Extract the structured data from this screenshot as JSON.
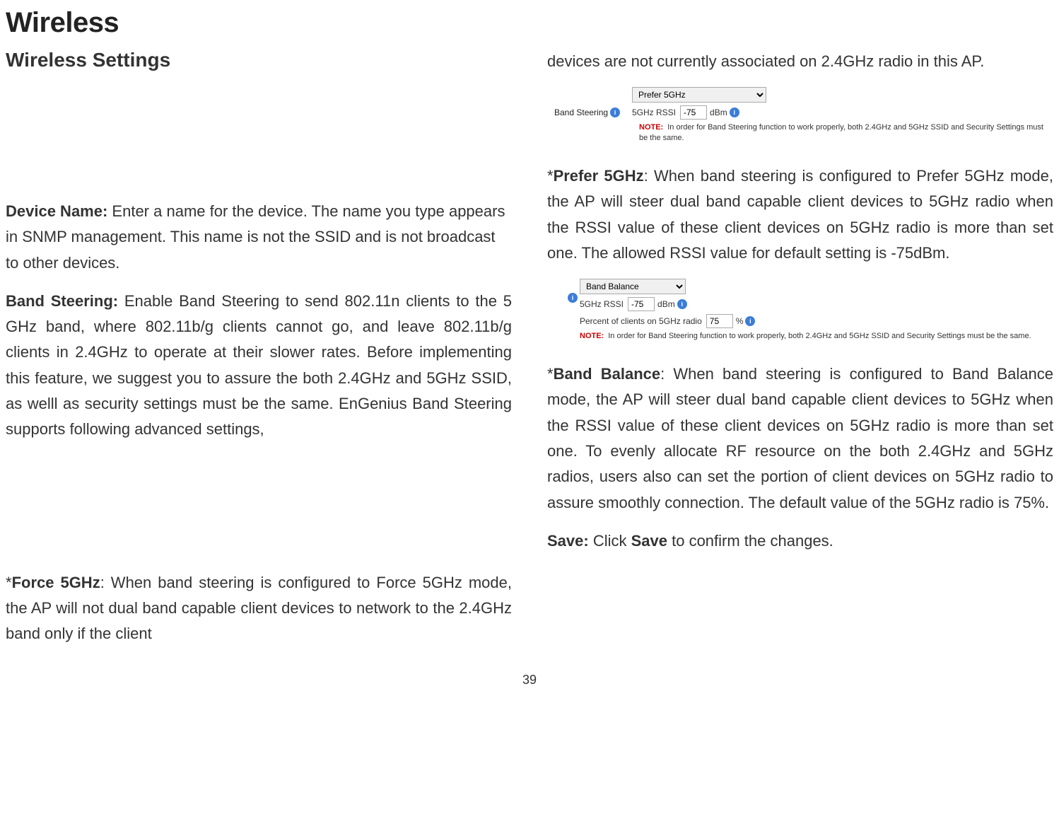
{
  "page": {
    "title": "Wireless",
    "number": "39"
  },
  "left": {
    "heading": "Wireless Settings",
    "deviceName": {
      "label": "Device Name:",
      "text": " Enter a name for the device. The name you type appears in SNMP management. This name is not the SSID and is not broadcast to other devices."
    },
    "bandSteering": {
      "label": "Band Steering:",
      "text": " Enable Band Steering to send 802.11n clients to the 5 GHz band, where 802.11b/g clients cannot go, and leave 802.11b/g clients in 2.4GHz to operate at their slower rates. Before implementing this feature, we suggest you to assure the both 2.4GHz and 5GHz SSID, as welll as security settings must be the same. EnGenius Band Steering supports following advanced settings,"
    },
    "force5": {
      "prefix": " *",
      "label": "Force 5GHz",
      "text": ": When band steering is configured to Force 5GHz mode, the AP will not dual band capable client devices to network to the 2.4GHz band only if the client"
    }
  },
  "right": {
    "contText": "devices are not currently associated on 2.4GHz radio in this AP.",
    "screenshot1": {
      "rowLabel": "Band Steering",
      "select": "Prefer 5GHz",
      "rssiLabel": "5GHz RSSI",
      "rssiValue": "-75",
      "rssiUnit": "dBm",
      "noteLabel": "NOTE:",
      "noteText": "In order for Band Steering function to work properly, both 2.4GHz and 5GHz SSID and Security Settings must be the same."
    },
    "prefer5": {
      "prefix": " *",
      "label": "Prefer 5GHz",
      "text": ": When band steering is configured to Prefer 5GHz  mode, the AP will steer dual band capable client devices to 5GHz radio when the RSSI value of these client devices on 5GHz radio is more than set one. The allowed RSSI value for default setting is -75dBm."
    },
    "screenshot2": {
      "select": "Band Balance",
      "rssiLabel": "5GHz RSSI",
      "rssiValue": "-75",
      "rssiUnit": "dBm",
      "pctLabel": "Percent of clients on 5GHz radio",
      "pctValue": "75",
      "pctUnit": "%",
      "noteLabel": "NOTE:",
      "noteText": "In order for Band Steering function to work properly, both 2.4GHz and 5GHz SSID and Security Settings must be the same."
    },
    "bandBalance": {
      "prefix": "  *",
      "label": "Band Balance",
      "text": ": When band steering is configured to Band Balance mode, the AP will steer dual band capable client devices to 5GHz when the RSSI value of these client devices on 5GHz radio is more than set one. To evenly allocate RF resource on the both 2.4GHz and 5GHz radios, users also can set the portion of client devices on 5GHz radio to assure smoothly connection. The default value of the 5GHz radio is 75%."
    },
    "save": {
      "label": "Save:",
      "text1": " Click ",
      "bold": "Save",
      "text2": " to confirm the changes."
    }
  }
}
